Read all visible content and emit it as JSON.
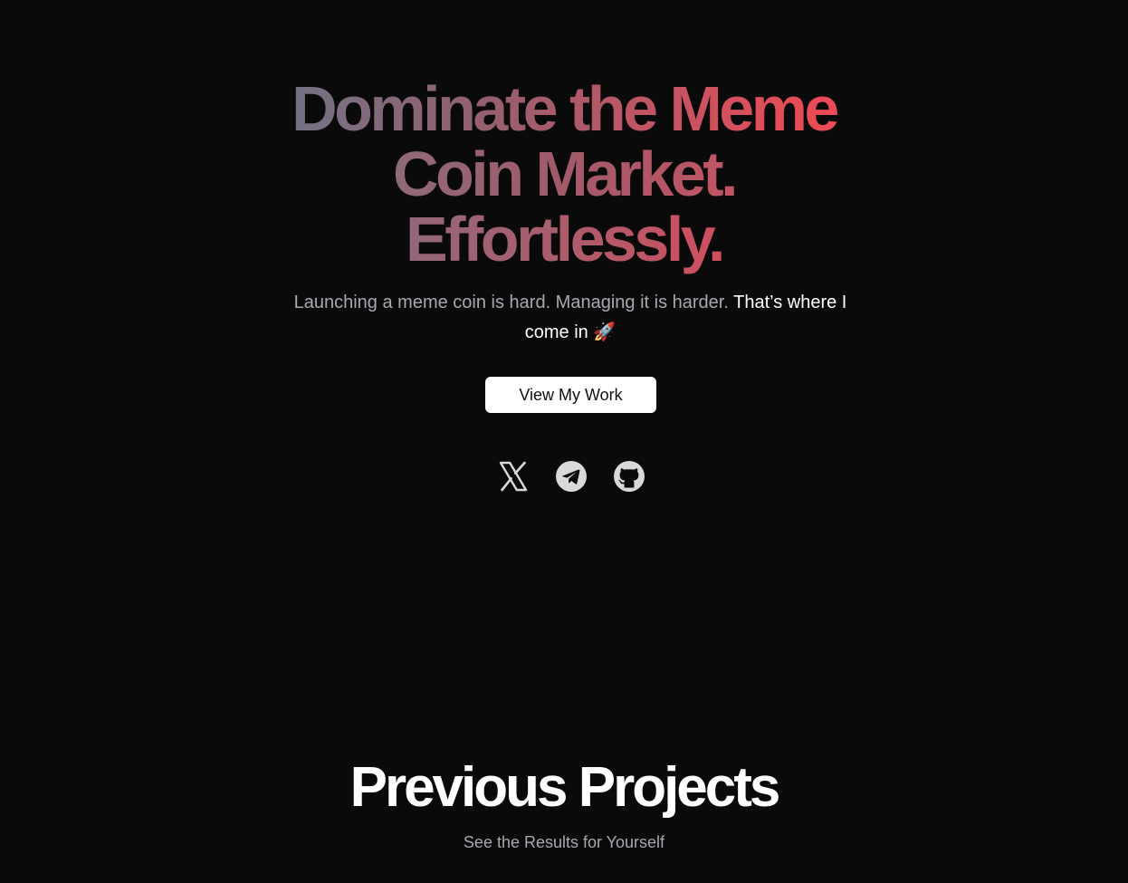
{
  "hero": {
    "title_line1": "Dominate the Meme",
    "title_line2": "Coin Market.",
    "title_line3": "Effortlessly.",
    "subtitle_muted": "Launching a meme coin is hard. Managing it is harder.",
    "subtitle_bright": "That’s where I come in 🚀",
    "cta_label": "View My Work",
    "gradient_colors": [
      "#737285",
      "#c05563",
      "#ef4a55"
    ]
  },
  "socials": [
    {
      "name": "x-icon"
    },
    {
      "name": "telegram-icon"
    },
    {
      "name": "github-icon"
    }
  ],
  "projects": {
    "title": "Previous Projects",
    "subtitle": "See the Results for Yourself"
  },
  "colors": {
    "background": "#0a0a0b",
    "muted_text": "#a8a8b0",
    "icon": "#d9d9d9"
  }
}
